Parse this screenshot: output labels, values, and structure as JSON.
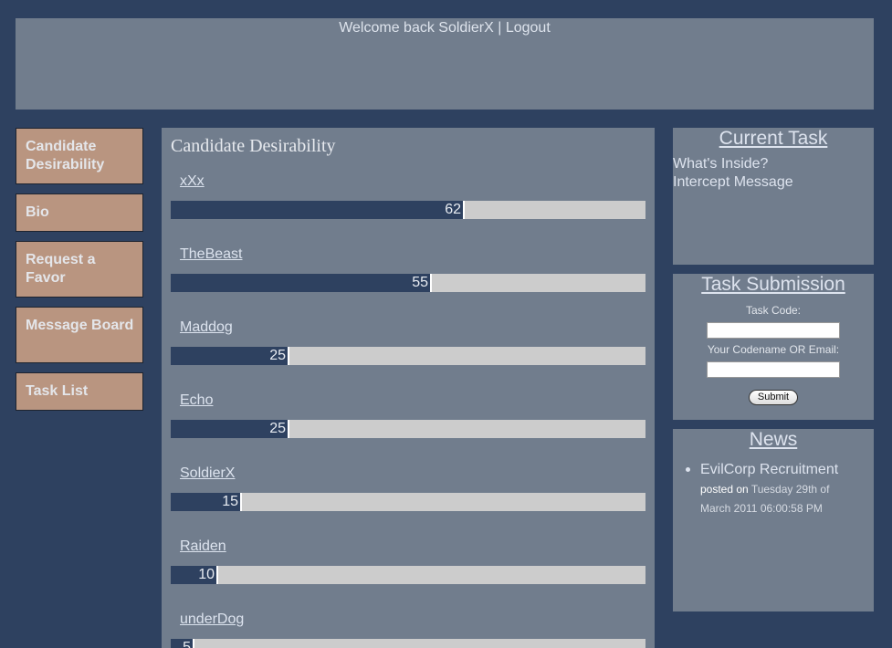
{
  "header": {
    "welcome_text": "Welcome back SoldierX",
    "separator": " | ",
    "logout_label": "Logout"
  },
  "nav": {
    "items": [
      {
        "label": "Candidate Desirability"
      },
      {
        "label": "Bio"
      },
      {
        "label": "Request a Favor"
      },
      {
        "label": "Message Board"
      },
      {
        "label": "Task List"
      }
    ]
  },
  "main": {
    "title": "Candidate Desirability",
    "candidates": [
      {
        "name": "xXx",
        "score": 62,
        "label": "62"
      },
      {
        "name": "TheBeast",
        "score": 55,
        "label": "55"
      },
      {
        "name": "Maddog",
        "score": 25,
        "label": "25"
      },
      {
        "name": "Echo",
        "score": 25,
        "label": "25"
      },
      {
        "name": "SoldierX",
        "score": 15,
        "label": "15"
      },
      {
        "name": "Raiden",
        "score": 10,
        "label": "10"
      },
      {
        "name": "underDog",
        "score": 5,
        "label": "5"
      }
    ]
  },
  "current_task": {
    "title": "Current Task",
    "lines": [
      "What's Inside?",
      "Intercept Message"
    ]
  },
  "task_submission": {
    "title": "Task Submission",
    "code_label": "Task Code:",
    "code_value": "",
    "codename_label": "Your Codename OR Email:",
    "codename_value": "",
    "submit_label": "Submit"
  },
  "news": {
    "title": "News",
    "items": [
      {
        "headline": "EvilCorp Recruitment",
        "posted_prefix": "posted on ",
        "date": "Tuesday 29th of March 2011 06:00:58 PM"
      }
    ]
  },
  "colors": {
    "background": "#2e4160",
    "panel": "#717d8d",
    "nav_button": "#b99580",
    "bar_fill": "#2e4160",
    "bar_track": "#cccccc"
  }
}
